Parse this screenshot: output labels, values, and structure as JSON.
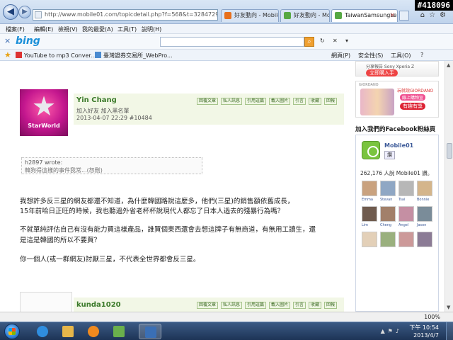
{
  "overlay_id": "#418096",
  "address": {
    "url": "http://www.mobile01.com/topicdetail.php?f=568&t=3284729&p="
  },
  "tabs": [
    {
      "label": "好友動向 - Mobile01"
    },
    {
      "label": "好友動向 - Mobile01"
    },
    {
      "label": "TaiwanSamsungLeaks..."
    }
  ],
  "menu": [
    "檔案(F)",
    "編輯(E)",
    "檢視(V)",
    "我的最愛(A)",
    "工具(T)",
    "說明(H)"
  ],
  "bing": {
    "logo": "bing",
    "close": "×",
    "search_placeholder": ""
  },
  "favorites": [
    {
      "label": "YouTube to mp3 Conver..."
    },
    {
      "label": "臺灣證券交易所_WebPro..."
    }
  ],
  "command_bar": [
    "網頁(P)",
    "安全性(S)",
    "工具(O)"
  ],
  "post": {
    "avatar_text": "StarWorld",
    "username": "Yin Chang",
    "user_links": "加入好友  加入黑名單",
    "date": "2013-04-07 22:29  #10484",
    "actions": [
      "回覆文章",
      "私人訊息",
      "引用這篇",
      "載入圖片",
      "引言",
      "收藏",
      "回報"
    ]
  },
  "quote": {
    "author": "h2897 wrote:",
    "text": "韓狗得這樣的事件我常...(恕刪)"
  },
  "paragraphs": [
    "我想許多反三星的網友都還不知道，為什麼韓國路說這麼多，他們(三星)的銷售額依舊成長，",
    "15年前哈日正旺的時候，我也聽過外省老杯杯說現代人都忘了日本人過去的殘暴行為嗎？",
    "不就單純評估自己有沒有能力買這樣產品，誰買個東西還會去想這牌子有無商道，有無用工讀生，還",
    "是這是韓國的所以不要買？",
    "你一個人(或一群網友)討厭三星，不代表全世界都會反三星。"
  ],
  "post2": {
    "username": "kunda1020",
    "actions": [
      "回覆文章",
      "私人訊息",
      "引用這篇",
      "載入圖片",
      "引言",
      "收藏",
      "回報"
    ]
  },
  "sidebar": {
    "ad1_line1": "分享報告 Sony Xperia Z",
    "ad1_line2": "立即購入手",
    "ad2_brand": "GIORDANO",
    "ad2_line1": "玩就說GIORDANO",
    "ad2_line2": "線上購物宣",
    "ad2_line3": "有趣有獎",
    "fb_title": "加入我們的Facebook粉絲頁",
    "fb_name": "Mobile01",
    "fb_like": "讚",
    "fb_count": "262,176 人說 Mobile01 讚。",
    "fb_fans": [
      "Emma",
      "Stevan",
      "Tsai",
      "Bonnie",
      "Lim",
      "Cheng",
      "Angel",
      "Jason"
    ]
  },
  "status": {
    "zoom": "100%"
  },
  "taskbar": {
    "time": "下午 10:54",
    "date": "2013/4/7"
  },
  "colors": {
    "accent_green": "#3b7a2a",
    "fb_blue": "#3b5998",
    "header_bg": "#f2f7e6"
  }
}
